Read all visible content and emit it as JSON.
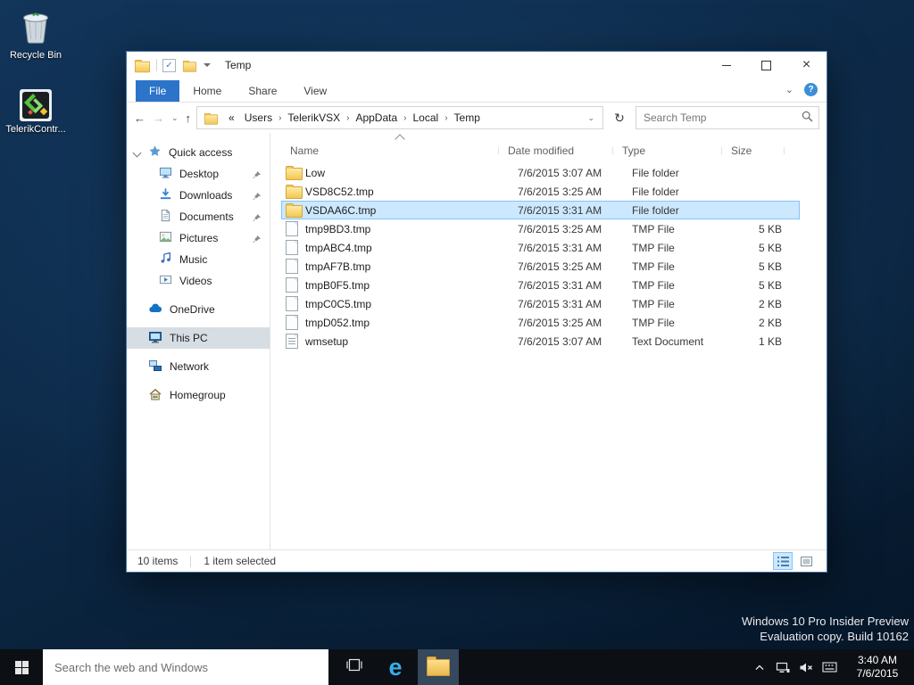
{
  "colors": {
    "accent_blue": "#2b74c9",
    "selection_bg": "#cce8ff",
    "selection_border": "#84c3f7",
    "sidebar_selected_bg": "#d6dde3",
    "folder_yellow": "#f3c84f",
    "taskbar_bg": "#0c0f14",
    "desktop_blue": "#0d2a49"
  },
  "icons": {
    "close": "×",
    "check": "✓",
    "back": "←",
    "forward": "→",
    "up": "↑",
    "chevron_down": "⌄",
    "qat_dropdown": "▾",
    "crumb_sep": "›",
    "refresh": "↻",
    "help": "?",
    "edge": "e"
  },
  "desktop": {
    "icons": [
      {
        "label": "Recycle Bin"
      },
      {
        "label": "TelerikContr..."
      }
    ],
    "watermark_line1": "Windows 10 Pro Insider Preview",
    "watermark_line2": "Evaluation copy. Build 10162"
  },
  "explorer": {
    "title": "Temp",
    "tabs": {
      "file": "File",
      "home": "Home",
      "share": "Share",
      "view": "View"
    },
    "address": {
      "overflow_prefix": "«",
      "crumbs": [
        "Users",
        "TelerikVSX",
        "AppData",
        "Local",
        "Temp"
      ],
      "search_placeholder": "Search Temp"
    },
    "sidebar": {
      "items": [
        {
          "label": "Quick access",
          "icon": "star",
          "selected": false
        },
        {
          "label": "Desktop",
          "icon": "desktop",
          "pinned": true
        },
        {
          "label": "Downloads",
          "icon": "downloads",
          "pinned": true
        },
        {
          "label": "Documents",
          "icon": "documents",
          "pinned": true
        },
        {
          "label": "Pictures",
          "icon": "pictures",
          "pinned": true
        },
        {
          "label": "Music",
          "icon": "music",
          "pinned": false
        },
        {
          "label": "Videos",
          "icon": "videos",
          "pinned": false
        },
        {
          "label": "OneDrive",
          "icon": "onedrive",
          "selected": false
        },
        {
          "label": "This PC",
          "icon": "this-pc",
          "selected": true
        },
        {
          "label": "Network",
          "icon": "network",
          "selected": false
        },
        {
          "label": "Homegroup",
          "icon": "homegroup",
          "selected": false
        }
      ]
    },
    "columns": {
      "name": "Name",
      "modified": "Date modified",
      "type": "Type",
      "size": "Size"
    },
    "files": [
      {
        "name": "Low",
        "modified": "7/6/2015 3:07 AM",
        "type": "File folder",
        "size": "",
        "kind": "folder",
        "selected": false
      },
      {
        "name": "VSD8C52.tmp",
        "modified": "7/6/2015 3:25 AM",
        "type": "File folder",
        "size": "",
        "kind": "folder",
        "selected": false
      },
      {
        "name": "VSDAA6C.tmp",
        "modified": "7/6/2015 3:31 AM",
        "type": "File folder",
        "size": "",
        "kind": "folder",
        "selected": true
      },
      {
        "name": "tmp9BD3.tmp",
        "modified": "7/6/2015 3:25 AM",
        "type": "TMP File",
        "size": "5 KB",
        "kind": "file",
        "selected": false
      },
      {
        "name": "tmpABC4.tmp",
        "modified": "7/6/2015 3:31 AM",
        "type": "TMP File",
        "size": "5 KB",
        "kind": "file",
        "selected": false
      },
      {
        "name": "tmpAF7B.tmp",
        "modified": "7/6/2015 3:25 AM",
        "type": "TMP File",
        "size": "5 KB",
        "kind": "file",
        "selected": false
      },
      {
        "name": "tmpB0F5.tmp",
        "modified": "7/6/2015 3:31 AM",
        "type": "TMP File",
        "size": "5 KB",
        "kind": "file",
        "selected": false
      },
      {
        "name": "tmpC0C5.tmp",
        "modified": "7/6/2015 3:31 AM",
        "type": "TMP File",
        "size": "2 KB",
        "kind": "file",
        "selected": false
      },
      {
        "name": "tmpD052.tmp",
        "modified": "7/6/2015 3:25 AM",
        "type": "TMP File",
        "size": "2 KB",
        "kind": "file",
        "selected": false
      },
      {
        "name": "wmsetup",
        "modified": "7/6/2015 3:07 AM",
        "type": "Text Document",
        "size": "1 KB",
        "kind": "textdoc",
        "selected": false
      }
    ],
    "status": {
      "count": "10 items",
      "selected": "1 item selected"
    }
  },
  "taskbar": {
    "search_placeholder": "Search the web and Windows",
    "time": "3:40 AM",
    "date": "7/6/2015"
  }
}
